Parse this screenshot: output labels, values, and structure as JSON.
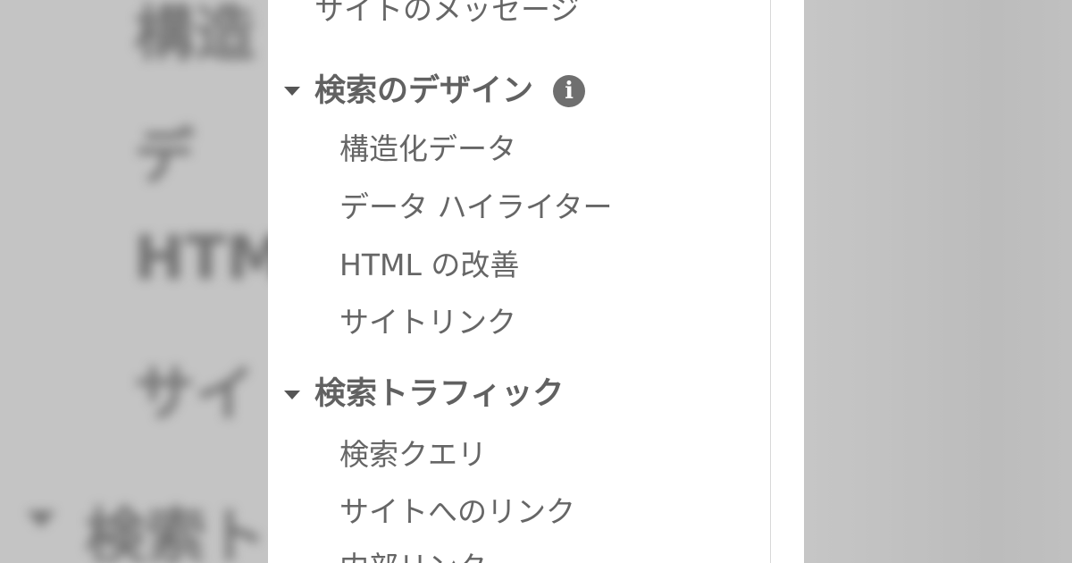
{
  "backdrop": {
    "left_fragments": [
      "構造",
      "デ",
      "HTM",
      "サイ",
      "検索ト"
    ]
  },
  "nav": {
    "site_messages": "サイトのメッセージ",
    "search_appearance": {
      "label": "検索のデザイン",
      "info_icon": "i",
      "items": [
        "構造化データ",
        "データ ハイライター",
        "HTML の改善",
        "サイトリンク"
      ]
    },
    "search_traffic": {
      "label": "検索トラフィック",
      "items": [
        "検索クエリ",
        "サイトへのリンク",
        "内部リンク"
      ]
    }
  },
  "icons": {
    "caret": "caret-down-icon",
    "info": "info-icon"
  },
  "colors": {
    "panel_bg": "#ffffff",
    "item_text": "#666666",
    "section_text": "#616161",
    "backdrop": "#bdbdbd"
  }
}
